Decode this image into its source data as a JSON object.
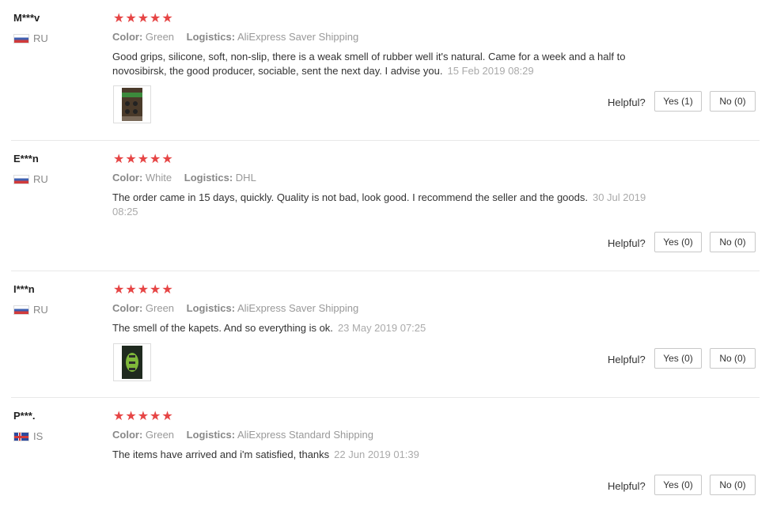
{
  "labels": {
    "color_key": "Color:",
    "logistics_key": "Logistics:",
    "helpful": "Helpful?"
  },
  "stars_glyph": "★★★★★",
  "accent_colors": {
    "stars": "#e64545",
    "muted": "#999999"
  },
  "reviews": [
    {
      "user": "M***v",
      "country": "RU",
      "flag": "russia-flag-icon",
      "color": "Green",
      "logistics": "AliExpress Saver Shipping",
      "text": "Good grips, silicone, soft, non-slip, there is a weak smell of rubber well it's natural. Came for a week and a half to novosibirsk, the good producer, sociable, sent the next day. I advise you.",
      "date": "15 Feb 2019 08:29",
      "has_photo": true,
      "yes": "Yes (1)",
      "no": "No (0)"
    },
    {
      "user": "E***n",
      "country": "RU",
      "flag": "russia-flag-icon",
      "color": "White",
      "logistics": "DHL",
      "text": "The order came in 15 days, quickly. Quality is not bad, look good. I recommend the seller and the goods.",
      "date": "30 Jul 2019 08:25",
      "has_photo": false,
      "yes": "Yes (0)",
      "no": "No (0)"
    },
    {
      "user": "I***n",
      "country": "RU",
      "flag": "russia-flag-icon",
      "color": "Green",
      "logistics": "AliExpress Saver Shipping",
      "text": "The smell of the kapets. And so everything is ok.",
      "date": "23 May 2019 07:25",
      "has_photo": true,
      "yes": "Yes (0)",
      "no": "No (0)"
    },
    {
      "user": "P***.",
      "country": "IS",
      "flag": "iceland-flag-icon",
      "color": "Green",
      "logistics": "AliExpress Standard Shipping",
      "text": "The items have arrived and i'm satisfied, thanks",
      "date": "22 Jun 2019 01:39",
      "has_photo": false,
      "yes": "Yes (0)",
      "no": "No (0)"
    }
  ]
}
